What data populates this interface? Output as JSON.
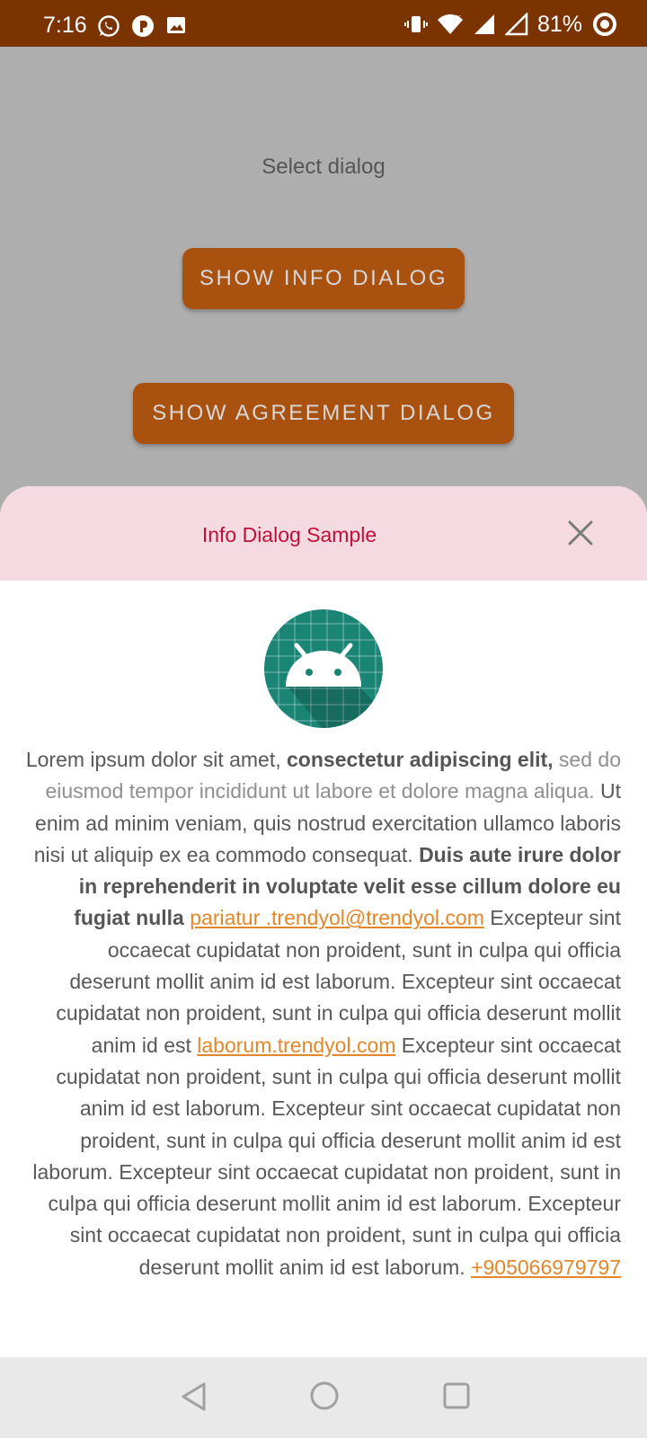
{
  "status_bar": {
    "time": "7:16",
    "battery": "81%",
    "left_icons": [
      "whatsapp-icon",
      "p-app-icon",
      "image-icon"
    ],
    "right_icons": [
      "vibrate-icon",
      "wifi-icon",
      "signal-icon",
      "signal-icon",
      "battery-ring-icon"
    ]
  },
  "screen": {
    "select_label": "Select dialog",
    "info_button": "SHOW INFO DIALOG",
    "agreement_button": "SHOW AGREEMENT DIALOG",
    "accent_color": "#a9520f"
  },
  "dialog": {
    "title": "Info Dialog Sample",
    "header_color": "#f5dbe1",
    "title_color": "#c0103a",
    "link_color": "#e3872a",
    "icon": "android-robot-icon",
    "body": {
      "p1": "Lorem ipsum dolor sit amet, ",
      "p2_bold": "consectetur adipiscing elit,",
      "p3_light": " sed do eiusmod tempor incididunt ut labore et dolore magna aliqua.",
      "p4": " Ut enim ad minim veniam, quis nostrud exercitation ullamco laboris nisi ut aliquip ex ea commodo consequat. ",
      "p5_bold": "Duis aute irure dolor in reprehenderit in voluptate velit esse cillum dolore eu fugiat nulla ",
      "link1": "pariatur .trendyol@trendyol.com",
      "p6": " Excepteur sint occaecat cupidatat non proident, sunt in culpa qui officia deserunt mollit anim id est laborum. Excepteur sint occaecat cupidatat non proident, sunt in culpa qui officia deserunt mollit anim id est ",
      "link2": "laborum.trendyol.com",
      "p7": " Excepteur sint occaecat cupidatat non proident, sunt in culpa qui officia deserunt mollit anim id est laborum. Excepteur sint occaecat cupidatat non proident, sunt in culpa qui officia deserunt mollit anim id est laborum. Excepteur sint occaecat cupidatat non proident, sunt in culpa qui officia deserunt mollit anim id est laborum. Excepteur sint occaecat cupidatat non proident, sunt in culpa qui officia deserunt mollit anim id est laborum. ",
      "link3": "+905066979797"
    }
  },
  "nav_bar": {
    "buttons": [
      "back-icon",
      "home-icon",
      "recents-icon"
    ]
  }
}
